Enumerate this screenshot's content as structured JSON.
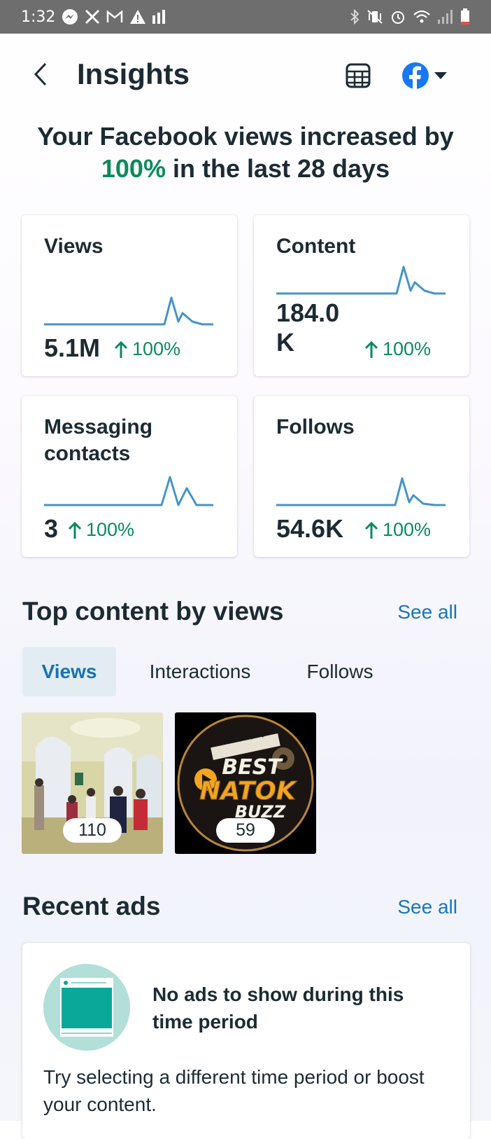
{
  "status_bar": {
    "time": "1:32"
  },
  "header": {
    "title": "Insights"
  },
  "headline": {
    "prefix": "Your Facebook views increased by",
    "highlight": "100%",
    "suffix": "in the last 28 days"
  },
  "metrics": [
    {
      "title": "Views",
      "value": "5.1M",
      "change": "100%"
    },
    {
      "title": "Content",
      "value_line1": "184.0",
      "value_line2": "K",
      "change": "100%"
    },
    {
      "title_line1": "Messaging",
      "title_line2": "contacts",
      "value": "3",
      "change": "100%"
    },
    {
      "title": "Follows",
      "value": "54.6K",
      "change": "100%"
    }
  ],
  "top_content": {
    "title": "Top content by views",
    "see_all": "See all",
    "tabs": [
      {
        "label": "Views",
        "active": true
      },
      {
        "label": "Interactions"
      },
      {
        "label": "Follows"
      }
    ],
    "items": [
      {
        "count": "110"
      },
      {
        "count": "59",
        "logo_text": [
          "BEST",
          "NATOK",
          "BUZZ"
        ]
      }
    ]
  },
  "recent_ads": {
    "title": "Recent ads",
    "see_all": "See all",
    "empty_heading": "No ads to show during this time period",
    "empty_body": "Try selecting a different time period or boost your content."
  },
  "colors": {
    "accent_green": "#0b8a5c",
    "link_blue": "#1875ba",
    "facebook_blue": "#1877f2",
    "spark_line": "#4594c7"
  }
}
